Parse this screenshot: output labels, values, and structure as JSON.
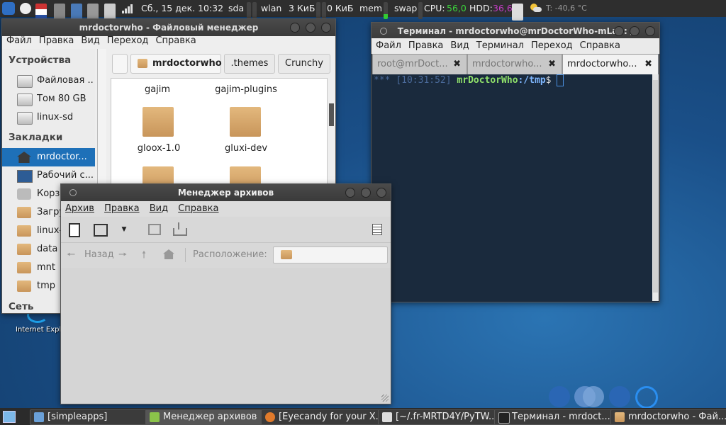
{
  "top_panel": {
    "datetime": "Сб., 15 дек. 10:32",
    "sda": "sda",
    "wlan": "wlan",
    "net_up": "3 КиБ",
    "net_down": "0 КиБ",
    "mem": "mem",
    "swap": "swap",
    "cpu_label": "CPU:",
    "cpu_value": "56,0",
    "hdd_label": "HDD:",
    "hdd_value": "36,6",
    "weather": "T: -40,6 °C"
  },
  "file_manager": {
    "title": "mrdoctorwho - Файловый менеджер",
    "menu": [
      "Файл",
      "Правка",
      "Вид",
      "Переход",
      "Справка"
    ],
    "path": [
      "mrdoctorwho",
      ".themes",
      "Crunchy"
    ],
    "sidebar": {
      "devices_header": "Устройства",
      "devices": [
        "Файловая ...",
        "Том 80 GB",
        "linux-sd"
      ],
      "bookmarks_header": "Закладки",
      "bookmarks": [
        "mrdoctor...",
        "Рабочий с...",
        "Корзи",
        "Загру",
        "linux-",
        "data",
        "mnt",
        "tmp"
      ],
      "network_header": "Сеть"
    },
    "files": [
      "gajim",
      "gajim-plugins",
      "gloox-1.0",
      "gluxi-dev"
    ]
  },
  "terminal": {
    "title": "Терминал - mrdoctorwho@mrDoctorWho-mLap: /",
    "menu": [
      "Файл",
      "Правка",
      "Вид",
      "Терминал",
      "Переход",
      "Справка"
    ],
    "tabs": [
      "root@mrDoct...",
      "mrdoctorwho...",
      "mrdoctorwho..."
    ],
    "prompt_stars": "***",
    "prompt_time": "[10:31:52]",
    "prompt_user": "mrDoctorWho",
    "prompt_path": ":/tmp",
    "prompt_dollar": "$"
  },
  "archive_manager": {
    "title": "Менеджер архивов",
    "menu": [
      "Архив",
      "Правка",
      "Вид",
      "Справка"
    ],
    "back_label": "Назад",
    "location_label": "Расположение:"
  },
  "desktop": {
    "ie_label": "Internet Expl..."
  },
  "taskbar": {
    "items": [
      "[simpleapps]",
      "Менеджер архивов",
      "[Eyecandy for your X...",
      "[~/.fr-MRTD4Y/PyTW...",
      "Терминал - mrdoct...",
      "mrdoctorwho - Фай..."
    ]
  },
  "colors": {
    "selection": "#1e70b8",
    "cpu_value": "#3bd33b",
    "hdd_value": "#c33cc3",
    "term_bg": "#1a2a3d",
    "prompt_user": "#8fe06a",
    "prompt_path": "#7fb7ff"
  }
}
